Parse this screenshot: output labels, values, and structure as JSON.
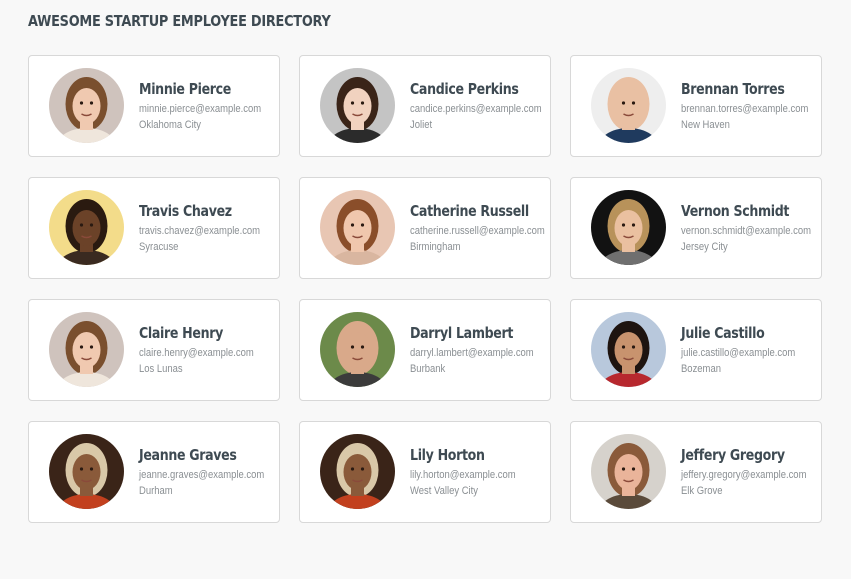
{
  "header": {
    "title": "AWESOME STARTUP EMPLOYEE DIRECTORY"
  },
  "employees": [
    {
      "name": "Minnie Pierce",
      "email": "minnie.pierce@example.com",
      "city": "Oklahoma City",
      "avatar": {
        "bg": "#cfc3bd",
        "skin": "#f0c9b0",
        "hair": "#7a4f2e",
        "shirt": "#efe6dc"
      }
    },
    {
      "name": "Candice Perkins",
      "email": "candice.perkins@example.com",
      "city": "Joliet",
      "avatar": {
        "bg": "#c4c4c4",
        "skin": "#f1d2bf",
        "hair": "#3a2418",
        "shirt": "#2b2b2b"
      }
    },
    {
      "name": "Brennan Torres",
      "email": "brennan.torres@example.com",
      "city": "New Haven",
      "avatar": {
        "bg": "#eeeeee",
        "skin": "#e9c0a3",
        "hair": "#e9c0a3",
        "shirt": "#1f3a5e"
      }
    },
    {
      "name": "Travis Chavez",
      "email": "travis.chavez@example.com",
      "city": "Syracuse",
      "avatar": {
        "bg": "#f3dc8a",
        "skin": "#6b4228",
        "hair": "#2a1a10",
        "shirt": "#3a2a20"
      }
    },
    {
      "name": "Catherine Russell",
      "email": "catherine.russell@example.com",
      "city": "Birmingham",
      "avatar": {
        "bg": "#e8c6b3",
        "skin": "#f0c7ad",
        "hair": "#8a4e2a",
        "shirt": "#d9b6a0"
      }
    },
    {
      "name": "Vernon Schmidt",
      "email": "vernon.schmidt@example.com",
      "city": "Jersey City",
      "avatar": {
        "bg": "#121212",
        "skin": "#eac0a0",
        "hair": "#b8925a",
        "shirt": "#6f6f6f"
      }
    },
    {
      "name": "Claire Henry",
      "email": "claire.henry@example.com",
      "city": "Los Lunas",
      "avatar": {
        "bg": "#cfc3bd",
        "skin": "#f0c9b0",
        "hair": "#7a4f2e",
        "shirt": "#efe6dc"
      }
    },
    {
      "name": "Darryl Lambert",
      "email": "darryl.lambert@example.com",
      "city": "Burbank",
      "avatar": {
        "bg": "#6c8a4a",
        "skin": "#d9a98a",
        "hair": "#d9a98a",
        "shirt": "#3b3b3b"
      }
    },
    {
      "name": "Julie Castillo",
      "email": "julie.castillo@example.com",
      "city": "Bozeman",
      "avatar": {
        "bg": "#b8c8dc",
        "skin": "#c8936e",
        "hair": "#1e1410",
        "shirt": "#b7282e"
      }
    },
    {
      "name": "Jeanne Graves",
      "email": "jeanne.graves@example.com",
      "city": "Durham",
      "avatar": {
        "bg": "#3a2418",
        "skin": "#8a5a3a",
        "hair": "#d9c8a8",
        "shirt": "#c2401e"
      }
    },
    {
      "name": "Lily Horton",
      "email": "lily.horton@example.com",
      "city": "West Valley City",
      "avatar": {
        "bg": "#3a2418",
        "skin": "#8a5a3a",
        "hair": "#d9c8a8",
        "shirt": "#c2401e"
      }
    },
    {
      "name": "Jeffery Gregory",
      "email": "jeffery.gregory@example.com",
      "city": "Elk Grove",
      "avatar": {
        "bg": "#d6d2cc",
        "skin": "#eab49a",
        "hair": "#8a5a3a",
        "shirt": "#5a4a3a"
      }
    }
  ]
}
